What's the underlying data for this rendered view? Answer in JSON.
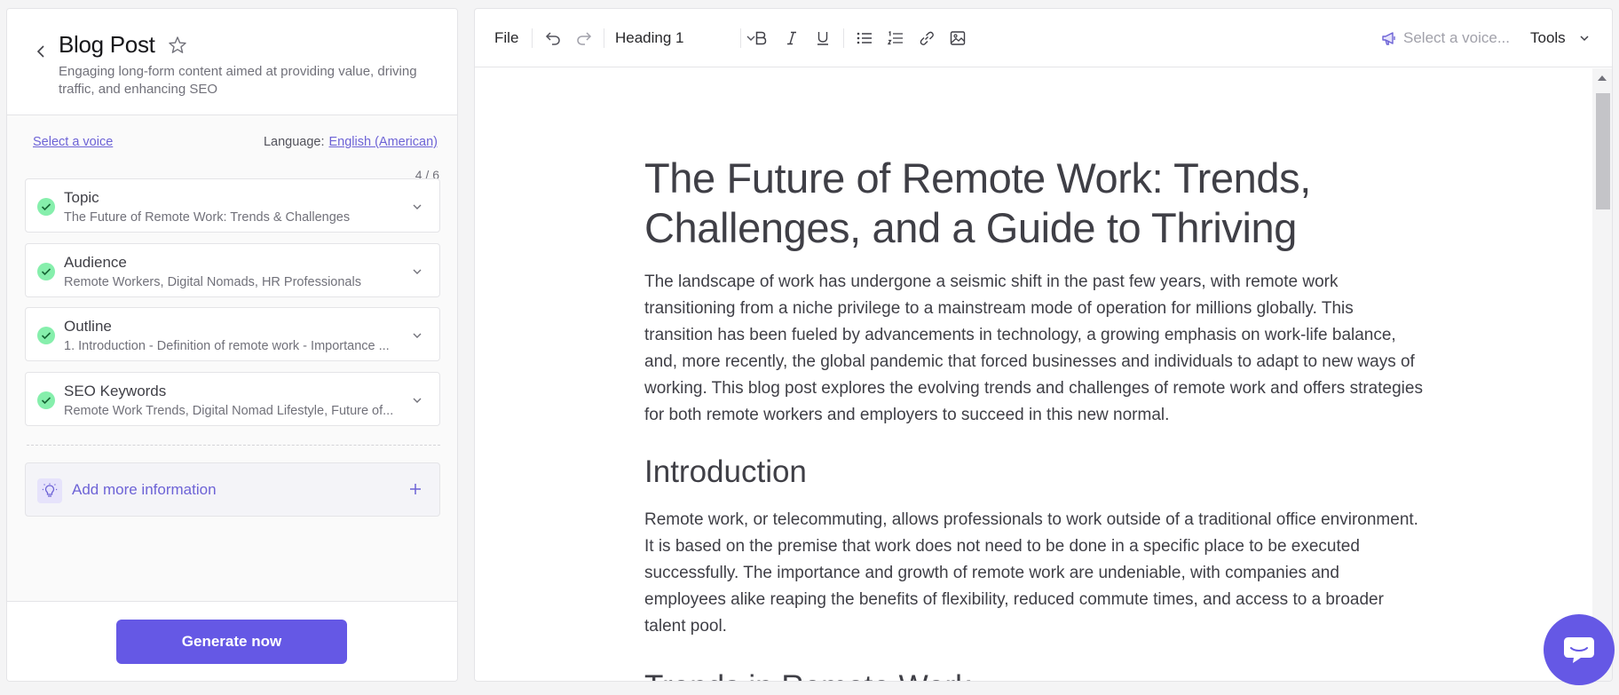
{
  "sidebar": {
    "title": "Blog Post",
    "description": "Engaging long-form content aimed at providing value, driving traffic, and enhancing SEO",
    "select_voice": "Select a voice",
    "language_label": "Language:",
    "language_value": "English (American)",
    "progress": "4 / 6",
    "cards": [
      {
        "title": "Topic",
        "value": "The Future of Remote Work: Trends & Challenges"
      },
      {
        "title": "Audience",
        "value": "Remote Workers, Digital Nomads, HR Professionals"
      },
      {
        "title": "Outline",
        "value": "1. Introduction - Definition of remote work - Importance ..."
      },
      {
        "title": "SEO Keywords",
        "value": "Remote Work Trends, Digital Nomad Lifestyle, Future of..."
      }
    ],
    "add_more": "Add more information",
    "generate": "Generate now"
  },
  "toolbar": {
    "file": "File",
    "block_style": "Heading 1",
    "voice_placeholder": "Select a voice...",
    "tools": "Tools"
  },
  "document": {
    "title": "The Future of Remote Work: Trends, Challenges, and a Guide to Thriving",
    "intro": "The landscape of work has undergone a seismic shift in the past few years, with remote work transitioning from a niche privilege to a mainstream mode of operation for millions globally. This transition has been fueled by advancements in technology, a growing emphasis on work-life balance, and, more recently, the global pandemic that forced businesses and individuals to adapt to new ways of working. This blog post explores the evolving trends and challenges of remote work and offers strategies for both remote workers and employers to succeed in this new normal.",
    "section1_heading": "Introduction",
    "section1_body": "Remote work, or telecommuting, allows professionals to work outside of a traditional office environment. It is based on the premise that work does not need to be done in a specific place to be executed successfully. The importance and growth of remote work are undeniable, with companies and employees alike reaping the benefits of flexibility, reduced commute times, and access to a broader talent pool.",
    "section2_heading": "Trends in Remote Work"
  },
  "colors": {
    "accent": "#6558e5",
    "link": "#6d63d6",
    "check": "#86efac"
  }
}
